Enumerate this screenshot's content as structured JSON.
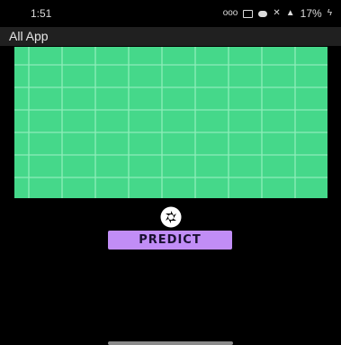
{
  "status_bar": {
    "time": "1:51",
    "battery_percent": "17%",
    "icons": [
      "voicemail-icon",
      "nfc-icon",
      "do-not-disturb-icon",
      "mute-icon",
      "signal-icon",
      "battery-charging-icon"
    ]
  },
  "app_bar": {
    "title": "All App"
  },
  "camera_preview": {
    "color": "#45d88a",
    "grid_color": "#9af0c2"
  },
  "controls": {
    "camera_icon": "camera-shutter-icon",
    "predict_label": "PREDICT",
    "predict_color": "#c18df6"
  }
}
